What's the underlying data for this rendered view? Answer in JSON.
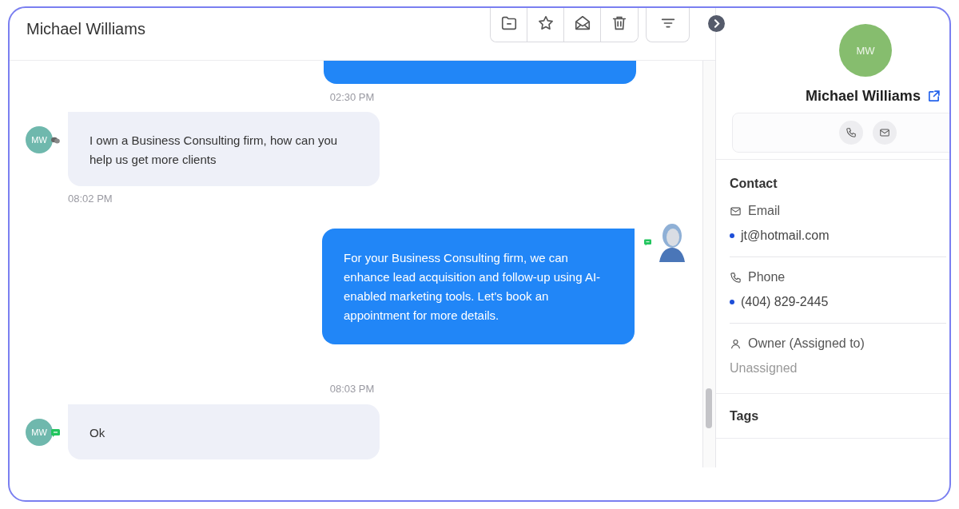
{
  "header": {
    "title": "Michael Williams"
  },
  "messages": [
    {
      "kind": "partial-outgoing",
      "time": "02:30 PM"
    },
    {
      "kind": "incoming",
      "avatar": "MW",
      "badge": {
        "kind": "chat"
      },
      "text": "I own a Business Consulting firm, how can you help us get more clients",
      "time": "08:02 PM"
    },
    {
      "kind": "outgoing",
      "badge": {
        "kind": "sms"
      },
      "text": "For your Business Consulting firm, we can enhance lead acquisition and follow-up using AI-enabled marketing tools. Let's book an appointment for more details.",
      "time": "08:03 PM"
    },
    {
      "kind": "incoming",
      "avatar": "MW",
      "badge": {
        "kind": "sms"
      },
      "text": "Ok"
    }
  ],
  "contact": {
    "initials": "MW",
    "name": "Michael Williams",
    "section": "Contact",
    "fields": [
      {
        "kind": "email",
        "label": "Email",
        "value": "jt@hotmail.com",
        "primary": true
      },
      {
        "kind": "phone",
        "label": "Phone",
        "value": "(404) 829-2445",
        "primary": true
      },
      {
        "kind": "owner",
        "label": "Owner (Assigned to)",
        "value": "Unassigned",
        "primary": false
      }
    ],
    "tags_heading": "Tags"
  }
}
